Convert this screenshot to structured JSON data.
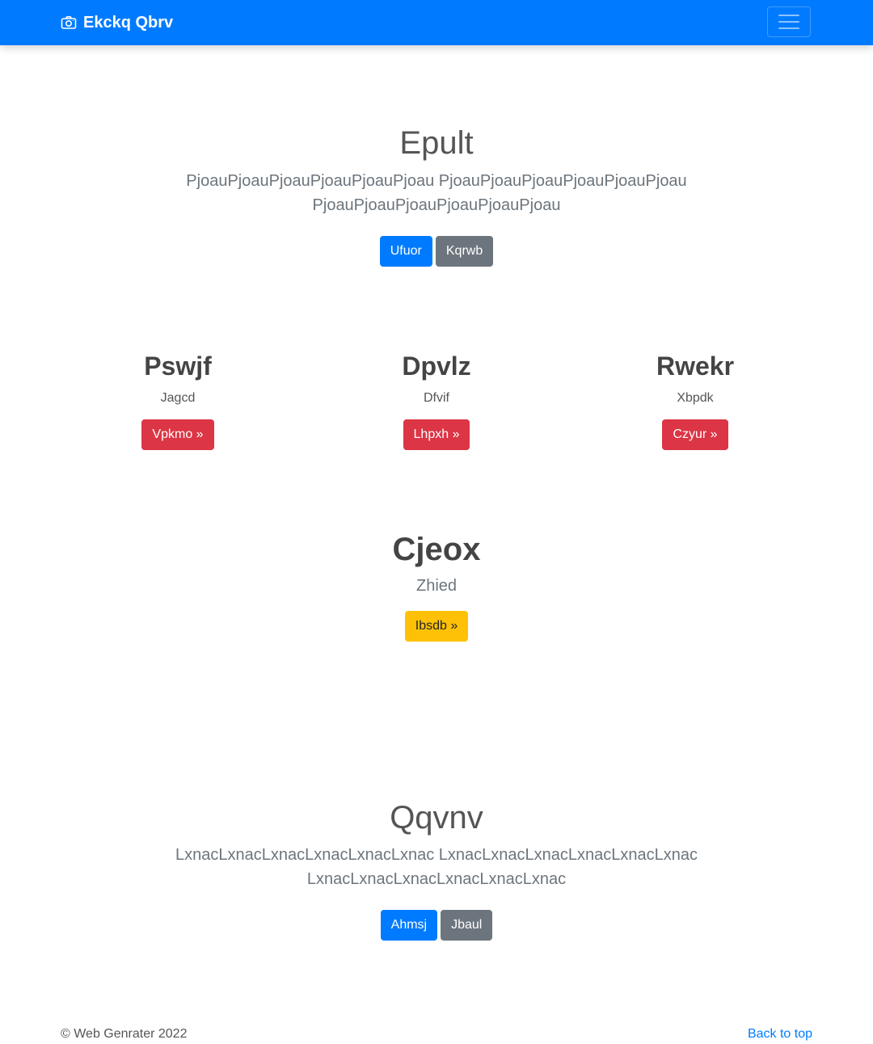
{
  "navbar": {
    "brand": "Ekckq Qbrv",
    "brand_icon": "camera-icon",
    "toggler_icon": "hamburger-menu-icon",
    "color": "#007bff"
  },
  "hero": {
    "title": "Epult",
    "lead_line1": "PjoauPjoauPjoauPjoauPjoauPjoau PjoauPjoauPjoauPjoauPjoauPjoau",
    "lead_line2": "PjoauPjoauPjoauPjoauPjoauPjoau",
    "primary_button": "Ufuor",
    "secondary_button": "Kqrwb"
  },
  "columns": [
    {
      "heading": "Pswjf",
      "text": "Jagcd",
      "button": "Vpkmo »"
    },
    {
      "heading": "Dpvlz",
      "text": "Dfvif",
      "button": "Lhpxh »"
    },
    {
      "heading": "Rwekr",
      "text": "Xbpdk",
      "button": "Czyur »"
    }
  ],
  "feature": {
    "heading": "Cjeox",
    "sub": "Zhied",
    "button": "Ibsdb »"
  },
  "section2": {
    "title": "Qqvnv",
    "lead_line1": "LxnacLxnacLxnacLxnacLxnacLxnac LxnacLxnacLxnacLxnacLxnacLxnac",
    "lead_line2": "LxnacLxnacLxnacLxnacLxnacLxnac",
    "primary_button": "Ahmsj",
    "secondary_button": "Jbaul"
  },
  "footer": {
    "copyright": "© Web Genrater 2022",
    "back_to_top": "Back to top"
  },
  "colors": {
    "primary": "#007bff",
    "secondary": "#6c757d",
    "danger": "#dc3545",
    "warning": "#ffc107"
  }
}
